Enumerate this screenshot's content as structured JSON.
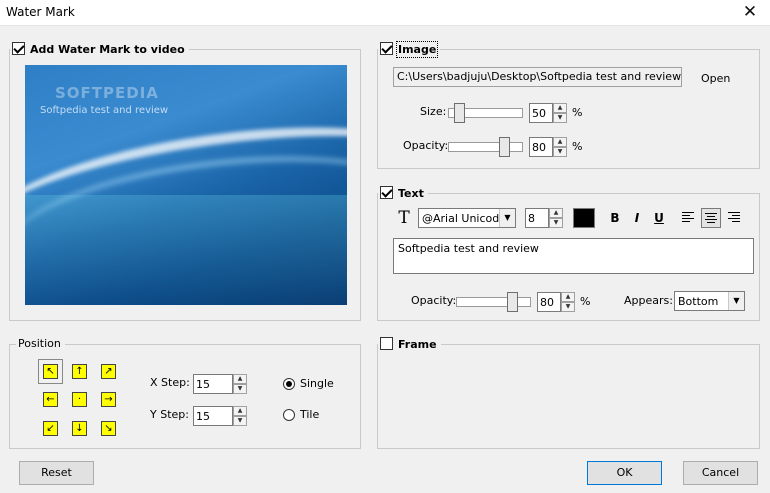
{
  "window": {
    "title": "Water Mark",
    "close_glyph": "✕"
  },
  "watermark": {
    "label": "Add Water Mark to video",
    "checked": true
  },
  "preview": {
    "logo": "SOFTPEDIA",
    "text": "Softpedia test and review"
  },
  "image": {
    "label": "Image",
    "checked": true,
    "path": "C:\\Users\\badjuju\\Desktop\\Softpedia test and review.png",
    "open_label": "Open",
    "size_label": "Size:",
    "size_value": "50",
    "size_level": 0.1,
    "opacity_label": "Opacity:",
    "opacity_value": "80",
    "opacity_level": 0.8,
    "percent": "%"
  },
  "text": {
    "label": "Text",
    "checked": true,
    "font_icon": "T",
    "font_name": "@Arial Unicode",
    "font_size": "8",
    "color": "#000000",
    "bold": "B",
    "italic": "I",
    "underline": "U",
    "content": "Softpedia test and review",
    "opacity_label": "Opacity:",
    "opacity_value": "80",
    "opacity_level": 0.8,
    "percent": "%",
    "appears_label": "Appears:",
    "appears_value": "Bottom"
  },
  "position": {
    "label": "Position",
    "arrows": [
      "↖",
      "↑",
      "↗",
      "←",
      "·",
      "→",
      "↙",
      "↓",
      "↘"
    ],
    "xstep_label": "X Step:",
    "xstep_value": "15",
    "ystep_label": "Y Step:",
    "ystep_value": "15",
    "single_label": "Single",
    "tile_label": "Tile",
    "mode": "Single"
  },
  "frame": {
    "label": "Frame",
    "checked": false
  },
  "buttons": {
    "reset": "Reset",
    "ok": "OK",
    "cancel": "Cancel"
  }
}
